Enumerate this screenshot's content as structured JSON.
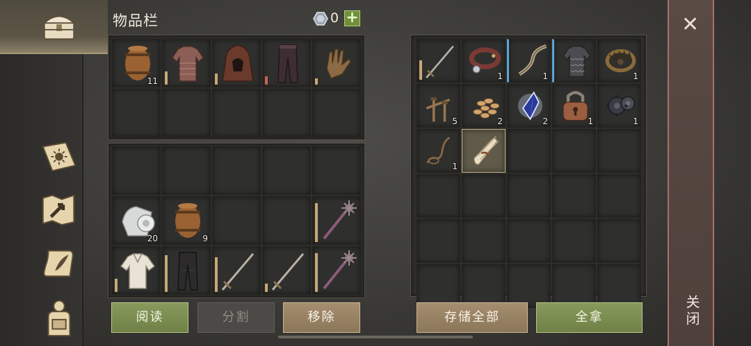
{
  "header": {
    "title": "物品栏",
    "currency_icon": "silver-gem-icon",
    "currency_count": "0",
    "add_label": "+"
  },
  "sidebar": {
    "items": [
      {
        "name": "chest-icon"
      },
      {
        "name": "sun-tome-icon"
      },
      {
        "name": "map-arrow-icon"
      },
      {
        "name": "scroll-quill-icon"
      },
      {
        "name": "character-backpack-icon"
      }
    ]
  },
  "equipment": {
    "slots": [
      {
        "icon": "barrel-icon",
        "qty": "11"
      },
      {
        "icon": "chainmail-shirt-icon",
        "durability": 0.3
      },
      {
        "icon": "leather-hood-icon",
        "durability": 0.25
      },
      {
        "icon": "leather-pants-icon",
        "durability": 0.2,
        "low": true
      },
      {
        "icon": "leather-gloves-icon",
        "durability": 0.15
      },
      {},
      {},
      {},
      {},
      {}
    ]
  },
  "backpack": {
    "slots": [
      {},
      {},
      {},
      {},
      {},
      {
        "icon": "cloth-roll-icon",
        "qty": "20"
      },
      {
        "icon": "barrel-icon",
        "qty": "9"
      },
      {},
      {},
      {
        "icon": "spiked-mace-icon",
        "durability": 0.9
      },
      {
        "icon": "linen-shirt-icon",
        "durability": 0.3
      },
      {
        "icon": "dark-pants-icon",
        "durability": 0.85
      },
      {
        "icon": "longsword-icon",
        "durability": 0.8
      },
      {
        "icon": "longsword-icon",
        "durability": 0.2
      },
      {
        "icon": "spiked-mace-icon",
        "durability": 0.9
      }
    ]
  },
  "container": {
    "slots": [
      {
        "icon": "longsword-icon",
        "durability": 0.5
      },
      {
        "icon": "leather-collar-icon",
        "qty": "1"
      },
      {
        "icon": "ornate-bow-icon",
        "qty": "1",
        "equip": true
      },
      {
        "icon": "scale-armor-icon",
        "equip": true
      },
      {
        "icon": "bear-trap-icon",
        "qty": "1"
      },
      {
        "icon": "nails-icon",
        "qty": "5"
      },
      {
        "icon": "seeds-icon",
        "qty": "2"
      },
      {
        "icon": "crystal-shard-icon",
        "qty": "2"
      },
      {
        "icon": "padlock-icon",
        "qty": "1"
      },
      {
        "icon": "gears-icon",
        "qty": "1"
      },
      {
        "icon": "rope-icon",
        "qty": "1"
      },
      {
        "icon": "scroll-bundle-icon",
        "selected": true
      },
      {},
      {},
      {},
      {},
      {},
      {},
      {},
      {},
      {},
      {},
      {},
      {},
      {},
      {},
      {},
      {},
      {},
      {}
    ]
  },
  "buttons": {
    "read": "阅读",
    "split": "分割",
    "remove": "移除",
    "store_all": "存储全部",
    "take_all": "全拿"
  },
  "close": {
    "icon": "close-icon",
    "label": "关闭"
  }
}
